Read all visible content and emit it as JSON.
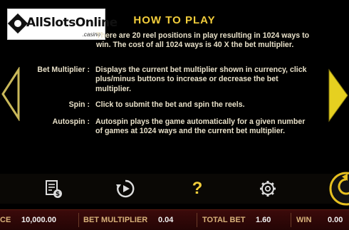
{
  "watermark": {
    "name": "AllSlotsOnline",
    "suffix": ".casino"
  },
  "help": {
    "title": "HOW TO PLAY",
    "intro": "There are 20 reel positions in play resulting in 1024 ways to win. The cost of all 1024 ways is 40 X the bet multiplier.",
    "rows": [
      {
        "label": "Bet Multiplier :",
        "desc": "Displays the current bet multiplier shown in currency, click plus/minus buttons to increase or decrease the bet multiplier."
      },
      {
        "label": "Spin :",
        "desc": "Click to submit the bet and spin the reels."
      },
      {
        "label": "Autospin :",
        "desc": "Autospin plays the game automatically for a given number of games at 1024 ways and the current bet multiplier."
      }
    ]
  },
  "toolbar": {
    "icons": [
      "paytable-dollar-icon",
      "autoplay-icon",
      "help-icon",
      "settings-icon",
      "spin-arrow-icon"
    ],
    "help_glyph": "?"
  },
  "status": {
    "balance_label": "CE",
    "balance_value": "10,000.00",
    "bet_label": "BET MULTIPLIER",
    "bet_value": "0.04",
    "total_label": "TOTAL BET",
    "total_value": "1.60",
    "win_label": "WIN",
    "win_value": "0.00"
  },
  "colors": {
    "title": "#f2cd3b",
    "text": "#e8e0c8",
    "arrow": "#e6d020",
    "status_bg": "#3b0a0a",
    "status_label": "#d8b27a"
  }
}
